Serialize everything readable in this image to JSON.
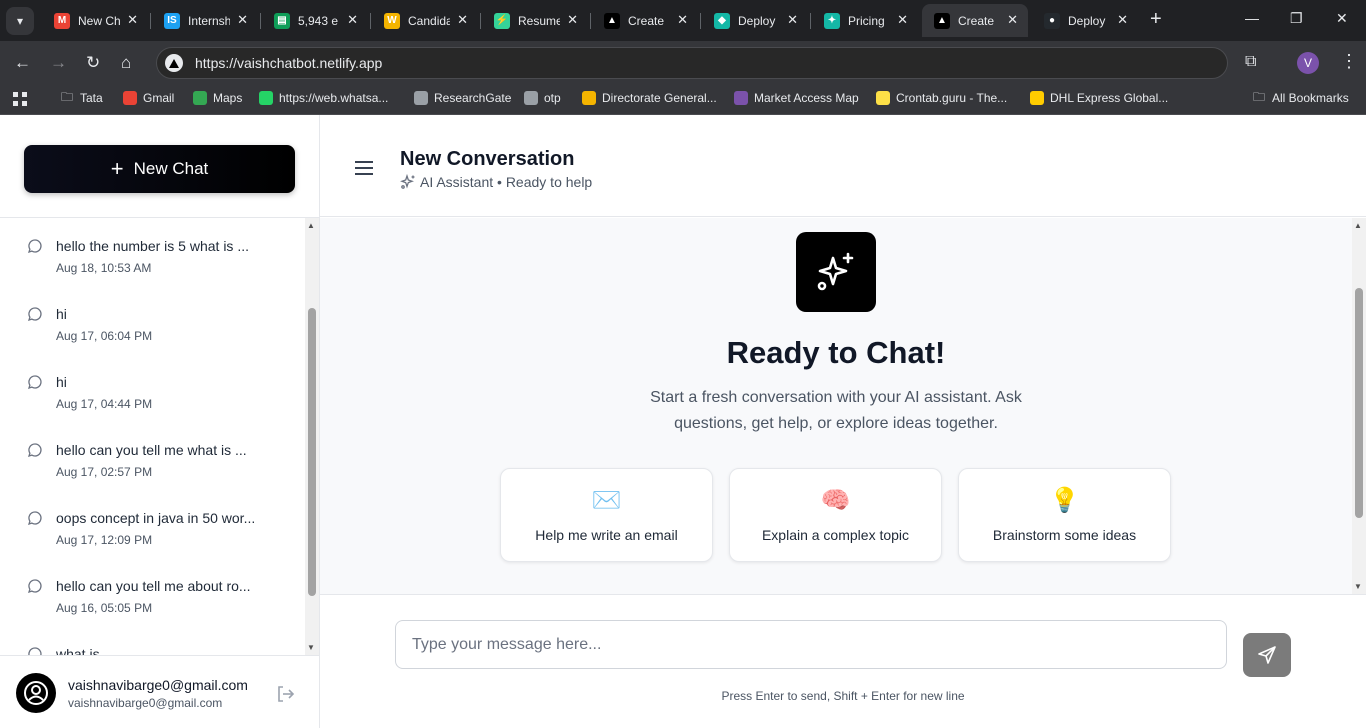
{
  "browser": {
    "tabs": [
      {
        "title": "New Ch",
        "favicon": "gmail-icon",
        "color": "#ea4335",
        "glyph": "M"
      },
      {
        "title": "Internsh",
        "favicon": "internshala-icon",
        "color": "#1da1f2",
        "glyph": "IS"
      },
      {
        "title": "5,943 e",
        "favicon": "sheet-icon",
        "color": "#0f9d58",
        "glyph": "▤"
      },
      {
        "title": "Candida",
        "favicon": "wp-icon",
        "color": "#f4b400",
        "glyph": "W"
      },
      {
        "title": "Resume",
        "favicon": "bolt-icon",
        "color": "#34d399",
        "glyph": "⚡"
      },
      {
        "title": "Create",
        "favicon": "vercel-icon",
        "color": "#000000",
        "glyph": "▲"
      },
      {
        "title": "Deploy",
        "favicon": "netlify-icon",
        "color": "#14b8a6",
        "glyph": "◆"
      },
      {
        "title": "Pricing",
        "favicon": "sparkle-icon",
        "color": "#14b8a6",
        "glyph": "✦"
      },
      {
        "title": "Create",
        "favicon": "vercel-icon",
        "color": "#000000",
        "glyph": "▲"
      },
      {
        "title": "Deploy",
        "favicon": "github-icon",
        "color": "#24292e",
        "glyph": "●"
      }
    ],
    "active_tab_index": 8,
    "url": "https://vaishchatbot.netlify.app",
    "profile_initial": "V",
    "bookmarks": [
      {
        "label": "Tata",
        "icon": "folder-icon"
      },
      {
        "label": "Gmail",
        "icon": "gmail-icon"
      },
      {
        "label": "Maps",
        "icon": "maps-icon"
      },
      {
        "label": "https://web.whatsa...",
        "icon": "whatsapp-icon"
      },
      {
        "label": "ResearchGate",
        "icon": "globe-icon"
      },
      {
        "label": "otp",
        "icon": "globe-icon"
      },
      {
        "label": "Directorate General...",
        "icon": "emblem-icon"
      },
      {
        "label": "Market Access Map",
        "icon": "map-icon"
      },
      {
        "label": "Crontab.guru - The...",
        "icon": "crontab-icon"
      },
      {
        "label": "DHL Express Global...",
        "icon": "dhl-icon"
      }
    ],
    "all_bookmarks_label": "All Bookmarks"
  },
  "sidebar": {
    "new_chat_label": "New Chat",
    "conversations": [
      {
        "title": "hello the number is 5 what is ...",
        "time": "Aug 18, 10:53 AM"
      },
      {
        "title": "hi",
        "time": "Aug 17, 06:04 PM"
      },
      {
        "title": "hi",
        "time": "Aug 17, 04:44 PM"
      },
      {
        "title": "hello can you tell me what is ...",
        "time": "Aug 17, 02:57 PM"
      },
      {
        "title": "oops concept in java in 50 wor...",
        "time": "Aug 17, 12:09 PM"
      },
      {
        "title": "hello can you tell me about ro...",
        "time": "Aug 16, 05:05 PM"
      },
      {
        "title": "what is ...",
        "time": ""
      }
    ],
    "user": {
      "name": "vaishnavibarge0@gmail.com",
      "email": "vaishnavibarge0@gmail.com"
    }
  },
  "header": {
    "title": "New Conversation",
    "subtitle": "AI Assistant • Ready to help"
  },
  "welcome": {
    "heading": "Ready to Chat!",
    "description": "Start a fresh conversation with your AI assistant. Ask questions, get help, or explore ideas together.",
    "suggestions": [
      {
        "icon": "✉️",
        "label": "Help me write an email"
      },
      {
        "icon": "🧠",
        "label": "Explain a complex topic"
      },
      {
        "icon": "💡",
        "label": "Brainstorm some ideas"
      }
    ]
  },
  "composer": {
    "placeholder": "Type your message here...",
    "value": "",
    "hint": "Press Enter to send, Shift + Enter for new line"
  },
  "colors": {
    "accent": "#000000",
    "send_button": "#7b7b7b",
    "content_bg": "#f8f9fb"
  }
}
